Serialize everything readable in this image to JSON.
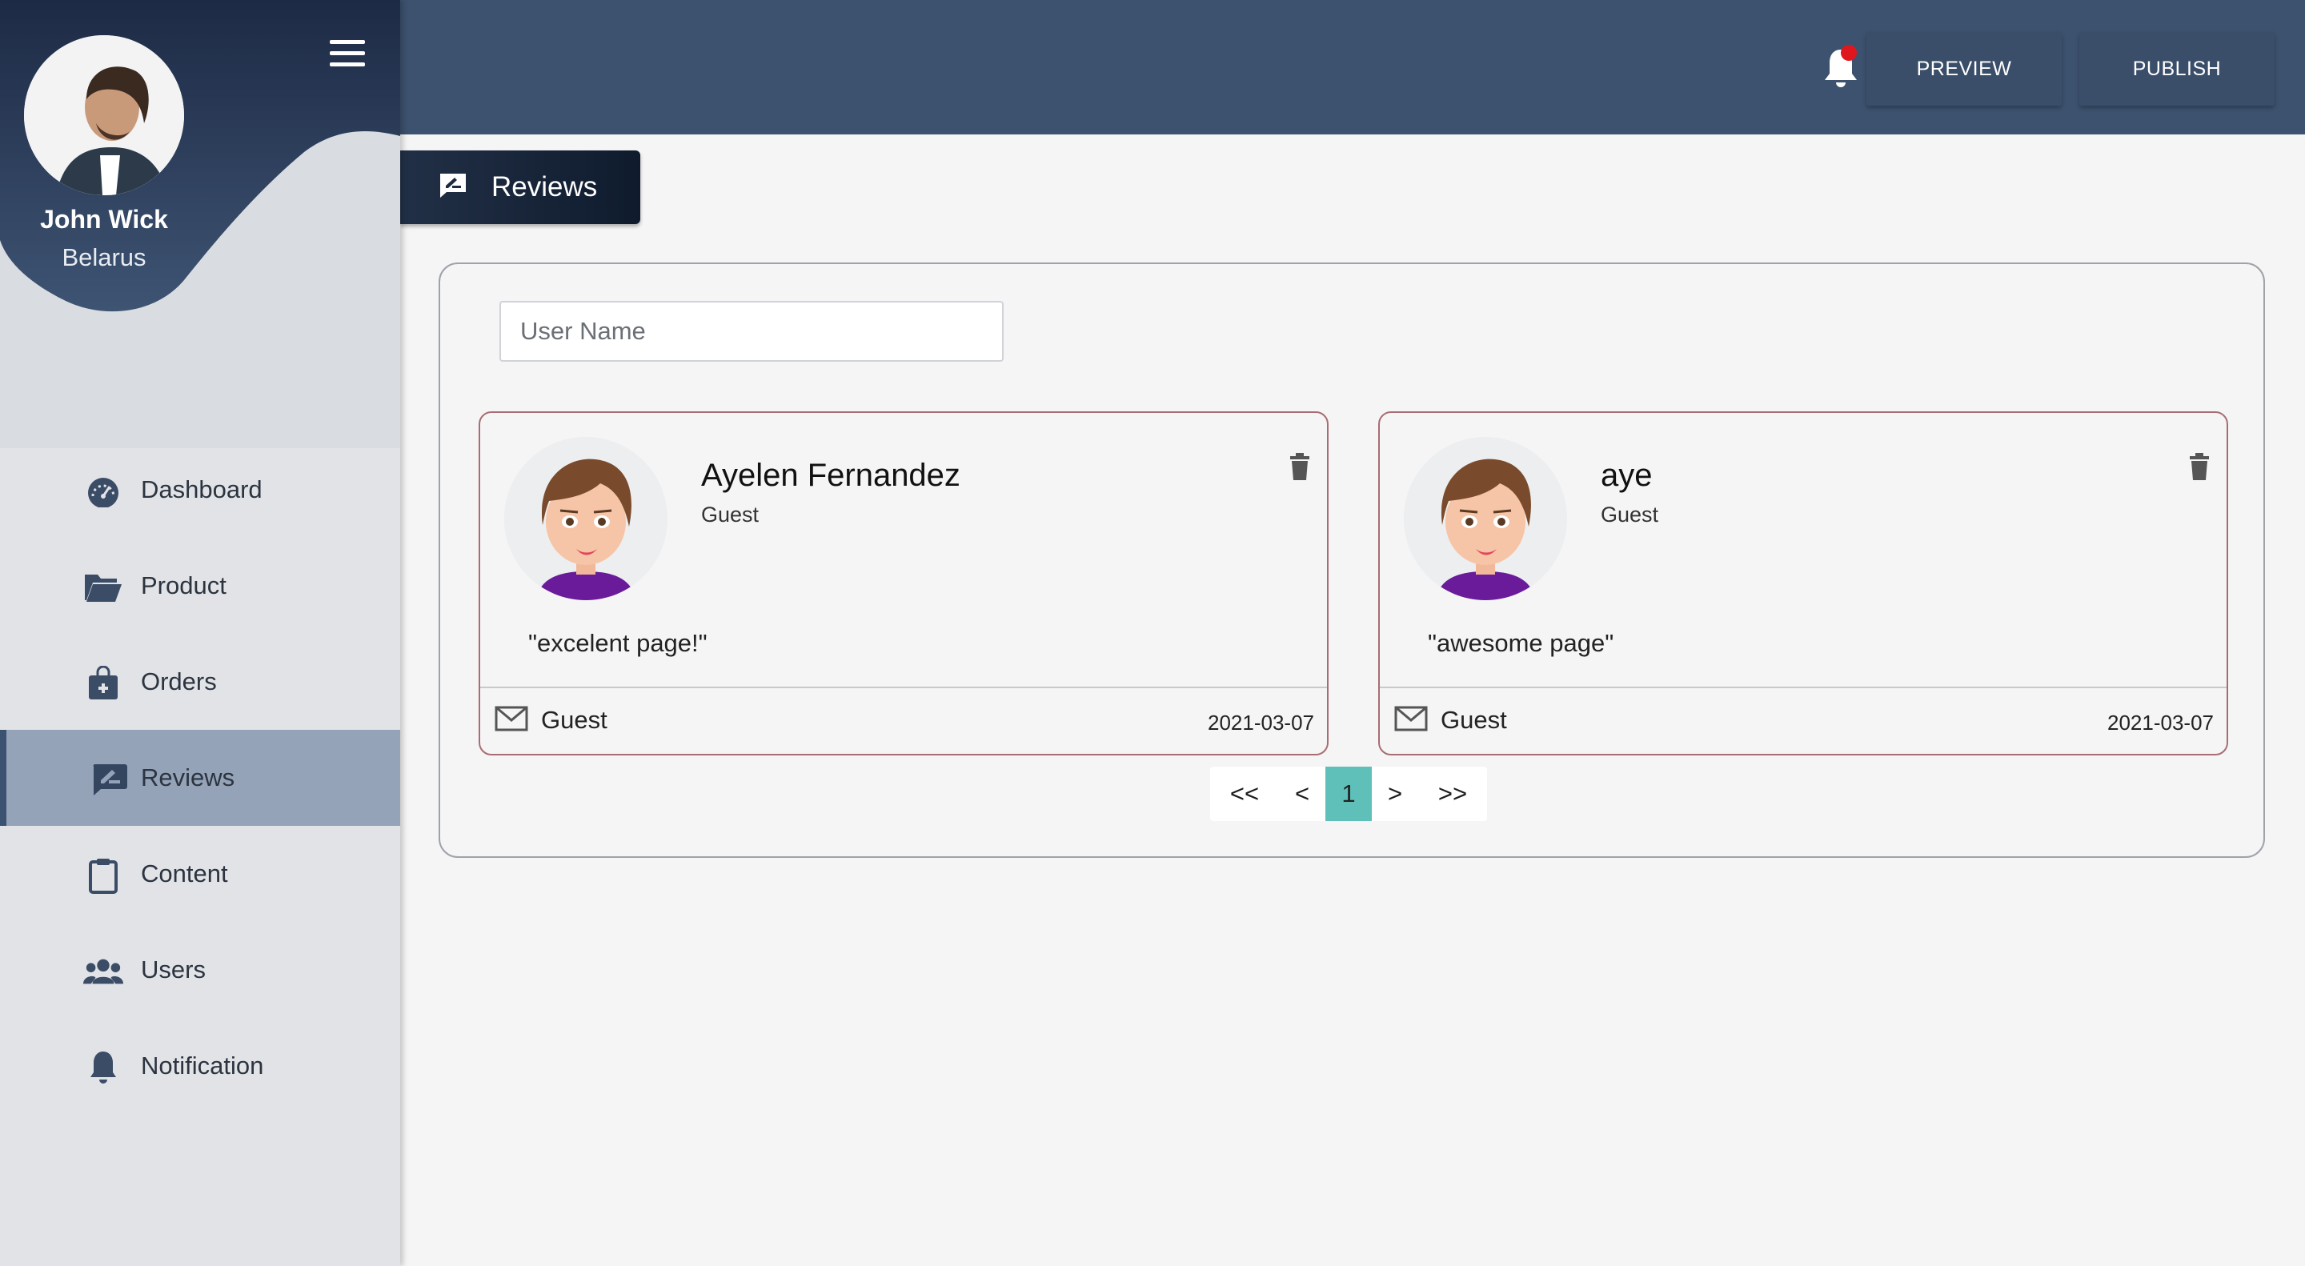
{
  "profile": {
    "name": "John Wick",
    "country": "Belarus"
  },
  "sidebar": {
    "items": [
      {
        "label": "Dashboard",
        "icon": "speedometer-icon",
        "active": false
      },
      {
        "label": "Product",
        "icon": "folder-open-icon",
        "active": false
      },
      {
        "label": "Orders",
        "icon": "shopping-bag-icon",
        "active": false
      },
      {
        "label": "Reviews",
        "icon": "rate-review-icon",
        "active": true
      },
      {
        "label": "Content",
        "icon": "clipboard-icon",
        "active": false
      },
      {
        "label": "Users",
        "icon": "users-icon",
        "active": false
      },
      {
        "label": "Notification",
        "icon": "bell-icon",
        "active": false
      }
    ]
  },
  "topbar": {
    "preview_label": "PREVIEW",
    "publish_label": "PUBLISH",
    "notification_unread": true
  },
  "page": {
    "tab_label": "Reviews"
  },
  "search": {
    "placeholder": "User Name",
    "value": ""
  },
  "reviews": [
    {
      "name": "Ayelen Fernandez",
      "role": "Guest",
      "comment": "\"excelent page!\"",
      "footer_name": "Guest",
      "date": "2021-03-07"
    },
    {
      "name": "aye",
      "role": "Guest",
      "comment": "\"awesome page\"",
      "footer_name": "Guest",
      "date": "2021-03-07"
    }
  ],
  "pagination": {
    "first": "<<",
    "prev": "<",
    "current": "1",
    "next": ">",
    "last": ">>"
  },
  "colors": {
    "topbar": "#3d526f",
    "sidebar": "#e1e3e7",
    "active_item": "#94a3b8",
    "pagination_active": "#5ec0b8",
    "card_border": "#a86d74",
    "notification_dot": "#e0161e"
  }
}
